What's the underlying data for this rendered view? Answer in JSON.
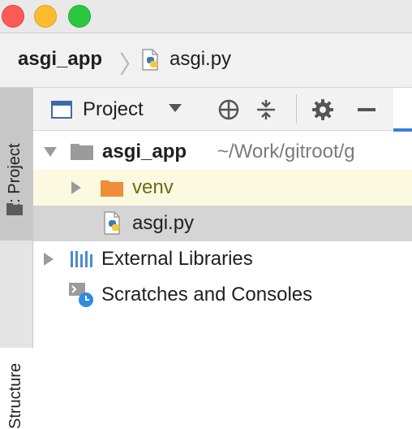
{
  "window": {
    "controls": [
      "close",
      "minimize",
      "zoom"
    ]
  },
  "breadcrumb": {
    "root": "asgi_app",
    "file": "asgi.py"
  },
  "left_strip": {
    "project_label": "1: Project",
    "structure_label": "Structure"
  },
  "toolbar": {
    "view_label": "Project",
    "icons": [
      "project-view-icon",
      "chevron-down-icon",
      "locate-target-icon",
      "collapse-all-icon",
      "gear-icon",
      "minimize-icon"
    ]
  },
  "tree": {
    "root": {
      "name": "asgi_app",
      "path": "~/Work/gitroot/g"
    },
    "venv": {
      "name": "venv"
    },
    "file": {
      "name": "asgi.py"
    },
    "external_libraries": {
      "name": "External Libraries"
    },
    "scratches": {
      "name": "Scratches and Consoles"
    }
  },
  "colors": {
    "selection": "#d5d5d5",
    "excluded_row": "#fbf9e0",
    "folder_orange": "#ef8d3a",
    "accent_blue": "#3b7fd8"
  }
}
